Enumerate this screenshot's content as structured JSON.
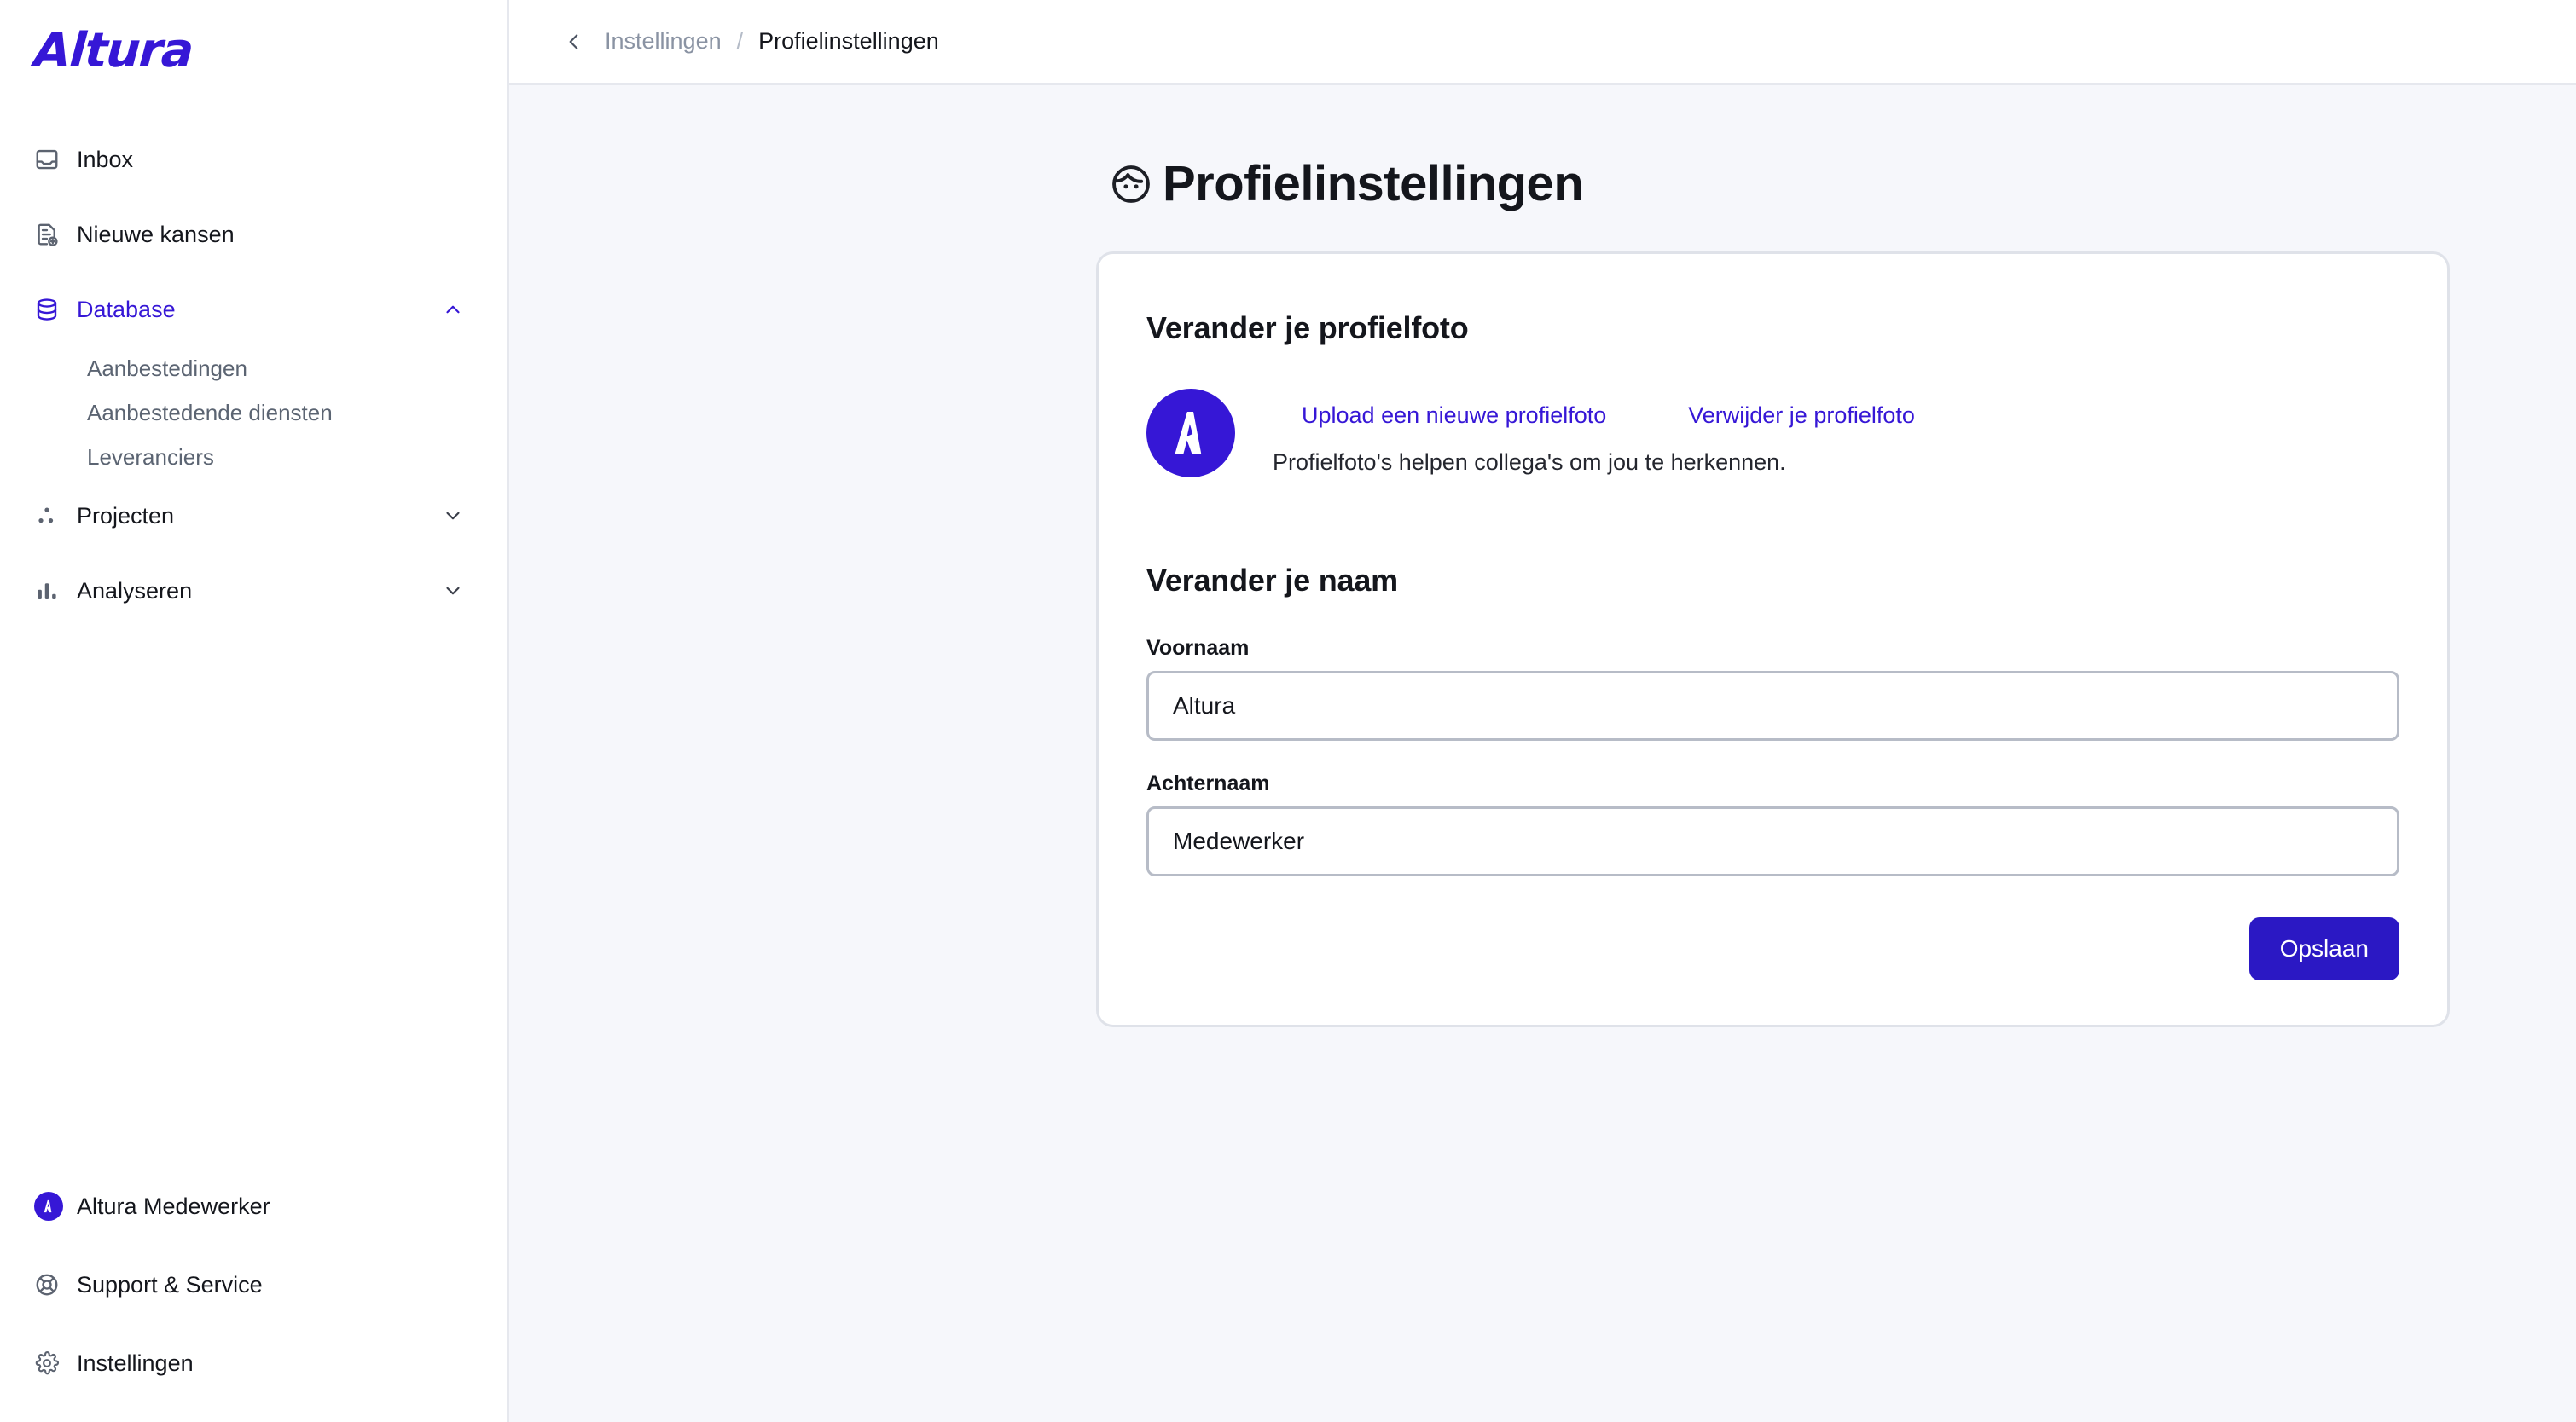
{
  "brand": {
    "logo_text": "Altura",
    "accent_color": "#3617d6",
    "button_color": "#2b18c4",
    "avatar_letter": "A"
  },
  "sidebar": {
    "nav": [
      {
        "label": "Inbox",
        "icon": "inbox-icon",
        "active": false,
        "expandable": false
      },
      {
        "label": "Nieuwe kansen",
        "icon": "document-plus-icon",
        "active": false,
        "expandable": false
      },
      {
        "label": "Database",
        "icon": "database-icon",
        "active": true,
        "expandable": true,
        "expanded": true
      }
    ],
    "database_children": [
      {
        "label": "Aanbestedingen"
      },
      {
        "label": "Aanbestedende diensten"
      },
      {
        "label": "Leveranciers"
      }
    ],
    "nav_lower": [
      {
        "label": "Projecten",
        "icon": "dots-triangle-icon",
        "active": false,
        "expandable": true,
        "expanded": false
      },
      {
        "label": "Analyseren",
        "icon": "bar-chart-icon",
        "active": false,
        "expandable": true,
        "expanded": false
      }
    ],
    "bottom": [
      {
        "label": "Altura Medewerker",
        "icon": "user-avatar-icon"
      },
      {
        "label": "Support & Service",
        "icon": "lifebuoy-icon"
      },
      {
        "label": "Instellingen",
        "icon": "gear-icon"
      }
    ]
  },
  "topbar": {
    "back_icon": "chevron-left-icon",
    "breadcrumb_parent": "Instellingen",
    "breadcrumb_separator": "/",
    "breadcrumb_current": "Profielinstellingen"
  },
  "page": {
    "title": "Profielinstellingen",
    "title_icon": "face-icon"
  },
  "photo_section": {
    "title": "Verander je profielfoto",
    "upload_link": "Upload een nieuwe profielfoto",
    "remove_link": "Verwijder je profielfoto",
    "hint": "Profielfoto's helpen collega's om jou te herkennen."
  },
  "name_section": {
    "title": "Verander je naam",
    "first_name_label": "Voornaam",
    "first_name_value": "Altura",
    "last_name_label": "Achternaam",
    "last_name_value": "Medewerker",
    "save_label": "Opslaan"
  }
}
